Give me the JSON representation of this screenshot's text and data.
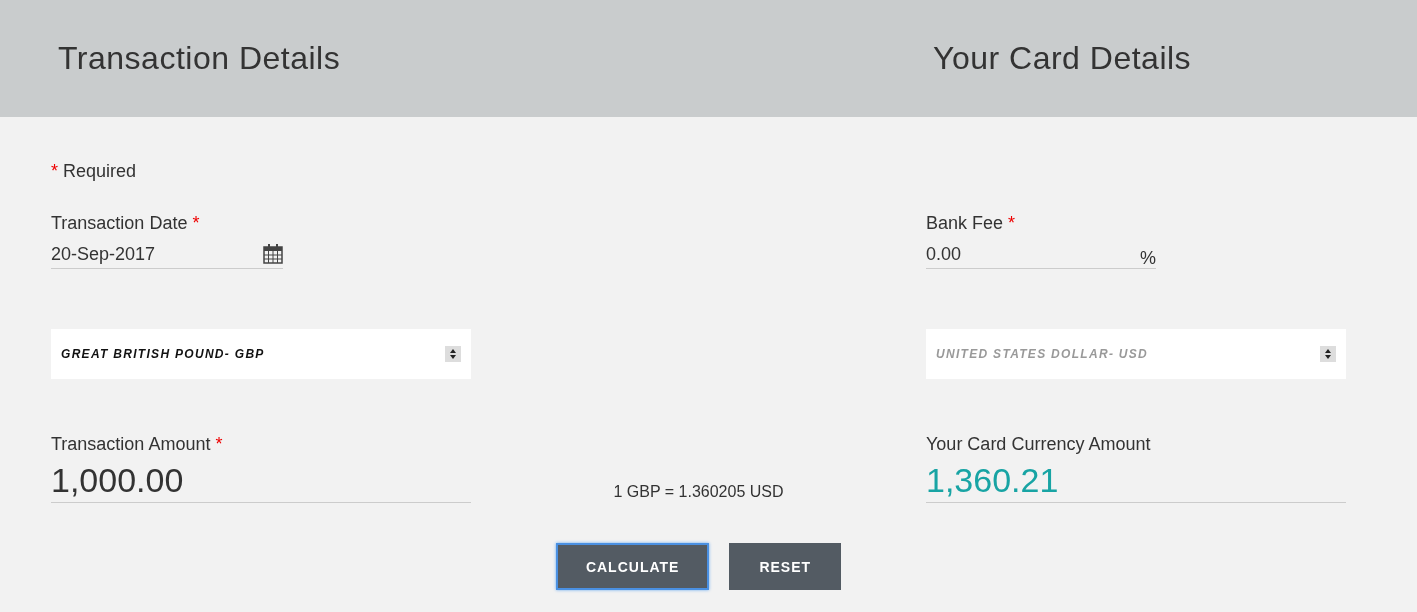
{
  "header": {
    "left_title": "Transaction Details",
    "right_title": "Your Card Details"
  },
  "required_note": {
    "mark": "*",
    "text": "Required"
  },
  "transaction": {
    "date_label": {
      "text": "Transaction Date",
      "mark": "*"
    },
    "date_value": "20-Sep-2017",
    "currency": {
      "value": "GREAT BRITISH POUND- GBP",
      "disabled": false
    },
    "amount_label": {
      "text": "Transaction Amount",
      "mark": "*"
    },
    "amount_value": "1,000.00"
  },
  "card": {
    "fee_label": {
      "text": "Bank Fee",
      "mark": "*"
    },
    "fee_value": "0.00",
    "fee_unit": "%",
    "currency": {
      "value": "UNITED STATES DOLLAR- USD",
      "disabled": true
    },
    "amount_label": {
      "text": "Your Card Currency Amount"
    },
    "amount_value": "1,360.21"
  },
  "rate": "1 GBP = 1.360205 USD",
  "buttons": [
    {
      "label": "CALCULATE",
      "focused": true
    },
    {
      "label": "RESET",
      "focused": false
    }
  ]
}
